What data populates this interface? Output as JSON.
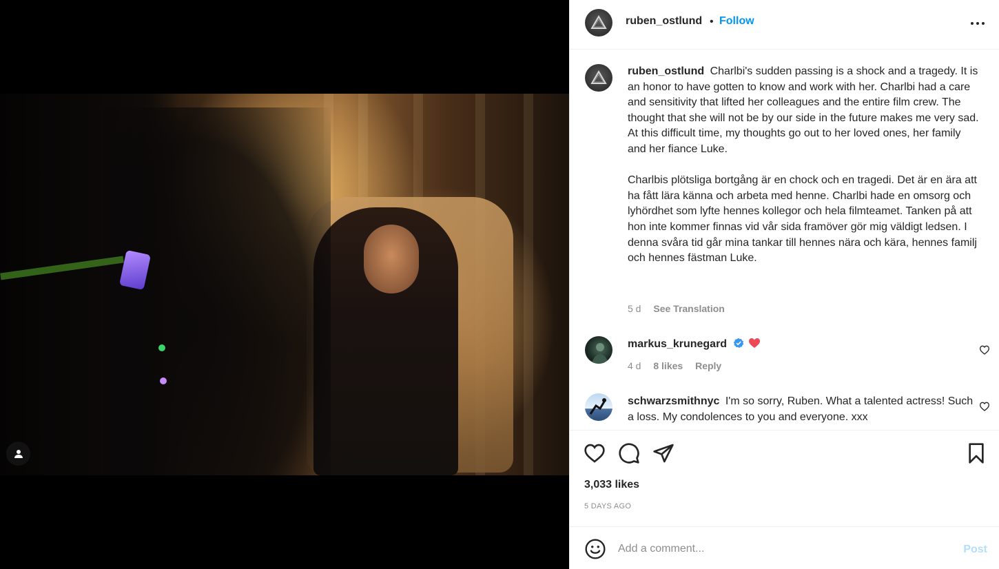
{
  "post": {
    "username": "ruben_ostlund",
    "follow_label": "Follow",
    "separator": "•"
  },
  "caption": {
    "username": "ruben_ostlund",
    "text_en": "Charlbi's sudden passing is a shock and a tragedy. It is an honor to have gotten to know and work with her. Charlbi had a care and sensitivity that lifted her colleagues and the entire film crew. The thought that she will not be by our side in the future makes me very sad. At this difficult time, my thoughts go out to her loved ones, her family and her fiance Luke.",
    "text_sv": "Charlbis plötsliga bortgång är en chock och en tragedi. Det är en ära att ha fått lära känna och arbeta med henne. Charlbi hade en omsorg och lyhördhet som lyfte hennes kollegor och hela filmteamet. Tanken på att hon inte kommer finnas vid vår sida framöver gör mig väldigt ledsen. I denna svåra tid går mina tankar till hennes nära och kära, hennes familj och hennes fästman Luke.",
    "age": "5 d",
    "see_translation": "See Translation"
  },
  "comments": [
    {
      "username": "markus_krunegard",
      "text": "",
      "age": "4 d",
      "likes": "8 likes",
      "reply": "Reply",
      "verified": true,
      "emoji": "red-heart"
    },
    {
      "username": "schwarzsmithnyc",
      "text": "I'm so sorry, Ruben. What a talented actress! Such a loss. My condolences to you and everyone. xxx"
    }
  ],
  "stats": {
    "likes": "3,033 likes",
    "date": "5 DAYS AGO"
  },
  "composer": {
    "placeholder": "Add a comment...",
    "post_label": "Post"
  },
  "colors": {
    "accent": "#0095f6",
    "post_disabled": "#b2dffc",
    "verified": "#3897f0",
    "heart": "#ed4956"
  }
}
